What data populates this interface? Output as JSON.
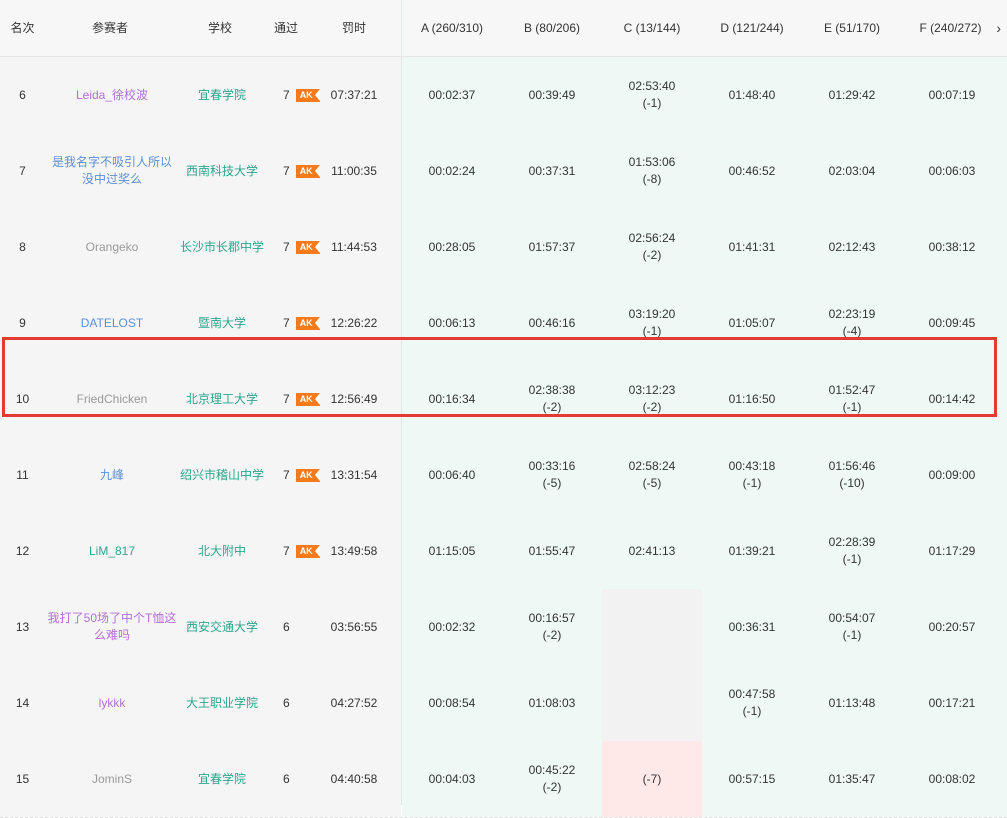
{
  "header": {
    "rank": "名次",
    "contestant": "参赛者",
    "school": "学校",
    "solved": "通过",
    "penalty": "罚时",
    "problems": [
      "A (260/310)",
      "B (80/206)",
      "C (13/144)",
      "D (121/244)",
      "E (51/170)",
      "F (240/272)"
    ],
    "scroll_right_icon": "chevron-right-icon"
  },
  "badge": "AK",
  "colors": {
    "purple": "#b56fd6",
    "blue": "#5b8fd6",
    "gray": "#9a9a9a",
    "green": "#2ca58d",
    "highlight": "#e53935",
    "ak_badge": "#f37b1d"
  },
  "rows": [
    {
      "rank": "6",
      "name": "Leida_徐校波",
      "name_color": "purple",
      "school": "宜春学院",
      "solved": "7",
      "ak": true,
      "penalty": "07:37:21",
      "problems": [
        {
          "time": "00:02:37"
        },
        {
          "time": "00:39:49"
        },
        {
          "time": "02:53:40",
          "tries": "(-1)"
        },
        {
          "time": "01:48:40"
        },
        {
          "time": "01:29:42"
        },
        {
          "time": "00:07:19"
        }
      ]
    },
    {
      "rank": "7",
      "name": "是我名字不吸引人所以没中过奖么",
      "name_color": "blue",
      "school": "西南科技大学",
      "solved": "7",
      "ak": true,
      "penalty": "11:00:35",
      "problems": [
        {
          "time": "00:02:24"
        },
        {
          "time": "00:37:31"
        },
        {
          "time": "01:53:06",
          "tries": "(-8)"
        },
        {
          "time": "00:46:52"
        },
        {
          "time": "02:03:04"
        },
        {
          "time": "00:06:03"
        }
      ]
    },
    {
      "rank": "8",
      "name": "Orangeko",
      "name_color": "gray",
      "school": "长沙市长郡中学",
      "solved": "7",
      "ak": true,
      "penalty": "11:44:53",
      "problems": [
        {
          "time": "00:28:05"
        },
        {
          "time": "01:57:37"
        },
        {
          "time": "02:56:24",
          "tries": "(-2)"
        },
        {
          "time": "01:41:31"
        },
        {
          "time": "02:12:43"
        },
        {
          "time": "00:38:12"
        }
      ]
    },
    {
      "rank": "9",
      "name": "DATELOST",
      "name_color": "blue",
      "school": "暨南大学",
      "solved": "7",
      "ak": true,
      "penalty": "12:26:22",
      "problems": [
        {
          "time": "00:06:13"
        },
        {
          "time": "00:46:16"
        },
        {
          "time": "03:19:20",
          "tries": "(-1)"
        },
        {
          "time": "01:05:07"
        },
        {
          "time": "02:23:19",
          "tries": "(-4)"
        },
        {
          "time": "00:09:45"
        }
      ]
    },
    {
      "rank": "10",
      "name": "FriedChicken",
      "name_color": "gray",
      "school": "北京理工大学",
      "solved": "7",
      "ak": true,
      "penalty": "12:56:49",
      "highlighted": true,
      "problems": [
        {
          "time": "00:16:34"
        },
        {
          "time": "02:38:38",
          "tries": "(-2)"
        },
        {
          "time": "03:12:23",
          "tries": "(-2)"
        },
        {
          "time": "01:16:50"
        },
        {
          "time": "01:52:47",
          "tries": "(-1)"
        },
        {
          "time": "00:14:42"
        }
      ]
    },
    {
      "rank": "11",
      "name": "九峰",
      "name_color": "blue",
      "school": "绍兴市稽山中学",
      "solved": "7",
      "ak": true,
      "penalty": "13:31:54",
      "problems": [
        {
          "time": "00:06:40"
        },
        {
          "time": "00:33:16",
          "tries": "(-5)"
        },
        {
          "time": "02:58:24",
          "tries": "(-5)"
        },
        {
          "time": "00:43:18",
          "tries": "(-1)"
        },
        {
          "time": "01:56:46",
          "tries": "(-10)"
        },
        {
          "time": "00:09:00"
        }
      ]
    },
    {
      "rank": "12",
      "name": "LiM_817",
      "name_color": "green",
      "school": "北大附中",
      "solved": "7",
      "ak": true,
      "penalty": "13:49:58",
      "problems": [
        {
          "time": "01:15:05"
        },
        {
          "time": "01:55:47"
        },
        {
          "time": "02:41:13"
        },
        {
          "time": "01:39:21"
        },
        {
          "time": "02:28:39",
          "tries": "(-1)"
        },
        {
          "time": "01:17:29"
        }
      ]
    },
    {
      "rank": "13",
      "name": "我打了50场了中个T恤这么难吗",
      "name_color": "purple",
      "school": "西安交通大学",
      "solved": "6",
      "ak": false,
      "penalty": "03:56:55",
      "problems": [
        {
          "time": "00:02:32"
        },
        {
          "time": "00:16:57",
          "tries": "(-2)"
        },
        {
          "state": "empty"
        },
        {
          "time": "00:36:31"
        },
        {
          "time": "00:54:07",
          "tries": "(-1)"
        },
        {
          "time": "00:20:57"
        }
      ]
    },
    {
      "rank": "14",
      "name": "lykkk",
      "name_color": "purple",
      "school": "大王职业学院",
      "solved": "6",
      "ak": false,
      "penalty": "04:27:52",
      "problems": [
        {
          "time": "00:08:54"
        },
        {
          "time": "01:08:03"
        },
        {
          "state": "empty"
        },
        {
          "time": "00:47:58",
          "tries": "(-1)"
        },
        {
          "time": "01:13:48"
        },
        {
          "time": "00:17:21"
        }
      ]
    },
    {
      "rank": "15",
      "name": "JominS",
      "name_color": "gray",
      "school": "宜春学院",
      "solved": "6",
      "ak": false,
      "penalty": "04:40:58",
      "problems": [
        {
          "time": "00:04:03"
        },
        {
          "time": "00:45:22",
          "tries": "(-2)"
        },
        {
          "state": "failed",
          "tries": "(-7)"
        },
        {
          "time": "00:57:15"
        },
        {
          "time": "01:35:47"
        },
        {
          "time": "00:08:02"
        }
      ]
    }
  ]
}
